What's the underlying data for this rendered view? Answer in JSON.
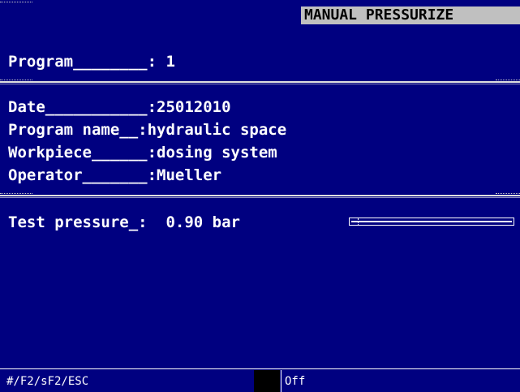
{
  "header": {
    "mode_title": "MANUAL PRESSURIZE"
  },
  "program": {
    "line": "Program________: 1"
  },
  "details": {
    "date": "Date___________:25012010",
    "program_name": "Program name__:hydraulic space",
    "workpiece": "Workpiece______:dosing system",
    "operator": "Operator_______:Mueller"
  },
  "measurement": {
    "line": "Test pressure_:  0.90 bar",
    "gauge_level_fraction": 0.0
  },
  "statusbar": {
    "keys": "#/F2/sF2/ESC",
    "state": "Off"
  },
  "colors": {
    "background": "#000080",
    "text": "#ffffff",
    "title_bg": "#c0c0c0"
  }
}
